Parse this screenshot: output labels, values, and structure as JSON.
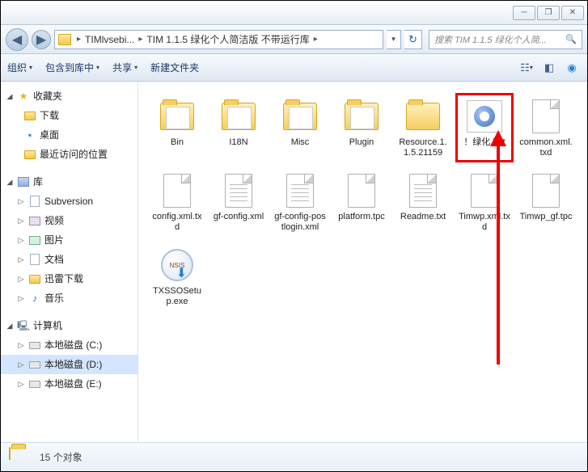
{
  "titlebar": {
    "min": "─",
    "max": "❐",
    "close": "✕"
  },
  "nav": {
    "back_glyph": "◀",
    "fwd_glyph": "▶"
  },
  "path": {
    "seg1": "TIMlvsebi...",
    "seg2": "TIM 1.1.5 绿化个人简洁版 不带运行库",
    "chev": "▸",
    "drop": "▾",
    "refresh": "↻"
  },
  "search": {
    "placeholder": "搜索 TIM 1.1.5 绿化个人简...",
    "icon": "🔍"
  },
  "toolbar": {
    "organize": "组织",
    "include": "包含到库中",
    "share": "共享",
    "newfolder": "新建文件夹",
    "drop": "▾"
  },
  "sidebar": {
    "favorites": {
      "label": "收藏夹",
      "items": [
        "下载",
        "桌面",
        "最近访问的位置"
      ]
    },
    "libraries": {
      "label": "库",
      "items": [
        "Subversion",
        "视频",
        "图片",
        "文档",
        "迅雷下载",
        "音乐"
      ]
    },
    "computer": {
      "label": "计算机",
      "items": [
        "本地磁盘 (C:)",
        "本地磁盘 (D:)",
        "本地磁盘 (E:)"
      ]
    }
  },
  "files": [
    {
      "name": "Bin",
      "type": "folder-open"
    },
    {
      "name": "I18N",
      "type": "folder-open"
    },
    {
      "name": "Misc",
      "type": "folder-open"
    },
    {
      "name": "Plugin",
      "type": "folder-open"
    },
    {
      "name": "Resource.1.1.5.21159",
      "type": "folder"
    },
    {
      "name": "！绿化.bat",
      "type": "bat",
      "highlighted": true
    },
    {
      "name": "common.xml.txd",
      "type": "file"
    },
    {
      "name": "config.xml.txd",
      "type": "file"
    },
    {
      "name": "gf-config.xml",
      "type": "file-lines"
    },
    {
      "name": "gf-config-postlogin.xml",
      "type": "file-lines"
    },
    {
      "name": "platform.tpc",
      "type": "file"
    },
    {
      "name": "Readme.txt",
      "type": "file-lines"
    },
    {
      "name": "Timwp.xml.txd",
      "type": "file"
    },
    {
      "name": "Timwp_gf.tpc",
      "type": "file"
    },
    {
      "name": "TXSSOSetup.exe",
      "type": "exe"
    }
  ],
  "status": {
    "count": "15 个对象"
  }
}
